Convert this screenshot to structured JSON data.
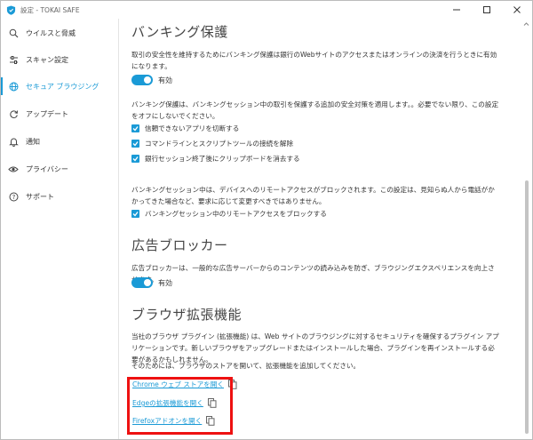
{
  "window": {
    "title": "設定 - TOKAI SAFE"
  },
  "sidebar": {
    "items": [
      {
        "label": "ウイルスと脅威",
        "icon": "scan-icon"
      },
      {
        "label": "スキャン設定",
        "icon": "sliders-icon"
      },
      {
        "label": "セキュア ブラウジング",
        "icon": "globe-icon",
        "active": true
      },
      {
        "label": "アップデート",
        "icon": "refresh-icon"
      },
      {
        "label": "通知",
        "icon": "bell-icon"
      },
      {
        "label": "プライバシー",
        "icon": "eye-icon"
      },
      {
        "label": "サポート",
        "icon": "help-icon"
      }
    ]
  },
  "banking": {
    "heading": "バンキング保護",
    "desc": "取引の安全性を維持するためにバンキング保護は銀行のWebサイトのアクセスまたはオンラインの決済を行うときに有効になります。",
    "toggle_label": "有効",
    "session_desc": "バンキング保護は、バンキングセッション中の取引を保護する追加の安全対策を適用します。。必要でない限り、この設定をオフにしないでください。",
    "options": [
      "信頼できないアプリを切断する",
      "コマンドラインとスクリプトツールの接続を解除",
      "銀行セッション終了後にクリップボードを消去する"
    ],
    "remote_desc": "バンキングセッション中は、デバイスへのリモートアクセスがブロックされます。この設定は、見知らぬ人から電話がかかってきた場合など、要求に応じて変更すべきではありません。",
    "remote_option": "バンキングセッション中のリモートアクセスをブロックする"
  },
  "adblock": {
    "heading": "広告ブロッカー",
    "desc": "広告ブロッカーは、一般的な広告サーバーからのコンテンツの読み込みを防ぎ、ブラウジングエクスペリエンスを向上させます。",
    "toggle_label": "有効"
  },
  "extensions": {
    "heading": "ブラウザ拡張機能",
    "desc": "当社のブラウザ プラグイン (拡張機能) は、Web サイトのブラウジングに対するセキュリティを確保するプラグイン アプリケーションです。新しいブラウザをアップグレードまたはインストールした場合、プラグインを再インストールする必要があるかもしれません。",
    "instruction": "そのためには、ブラウザのストアを開いて、拡張機能を追加してください。",
    "links": [
      "Chrome ウェブ ストアを開く",
      "Edgeの拡張機能を開く",
      "Firefoxアドオンを開く"
    ]
  },
  "colors": {
    "accent": "#1a9ad6",
    "highlight": "#ee1111"
  }
}
